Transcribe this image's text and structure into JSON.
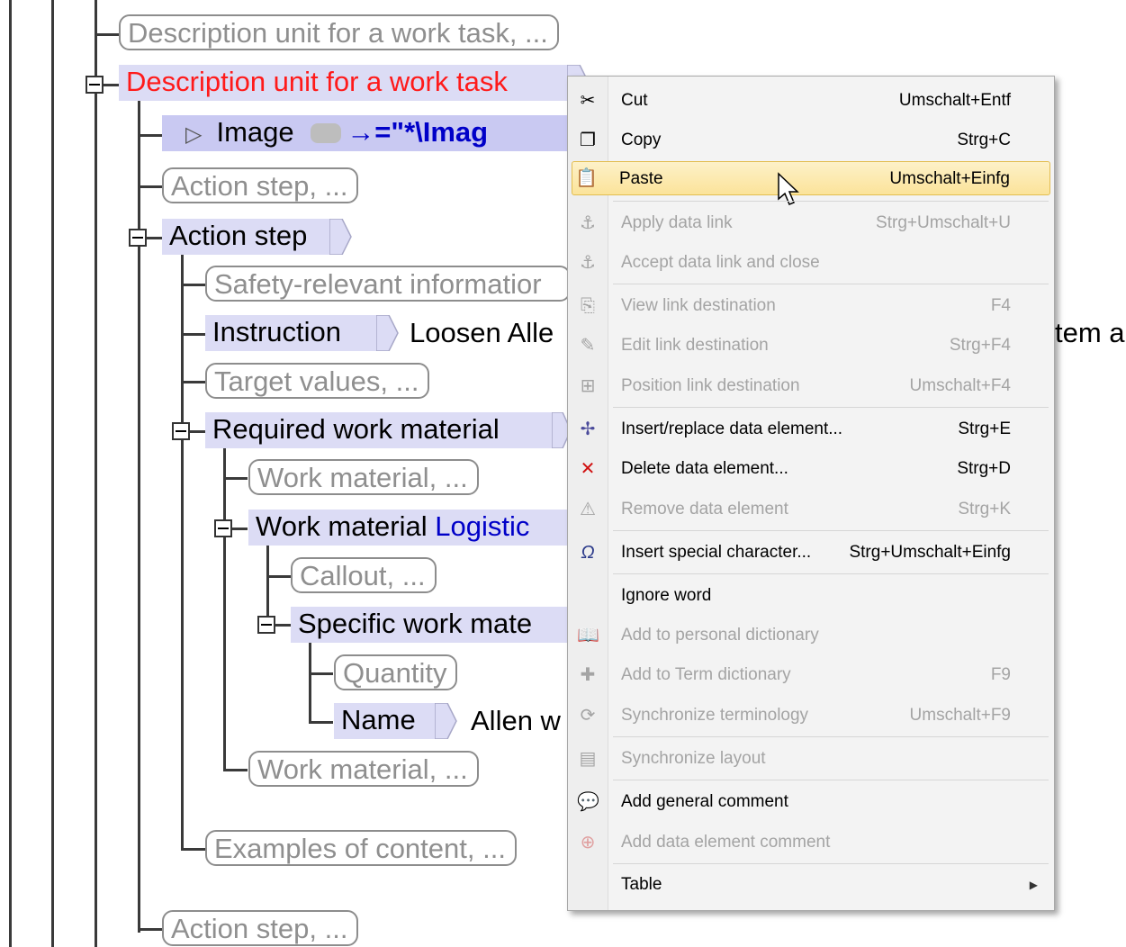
{
  "tree": {
    "row0": "Description unit for a work task, ...",
    "row1": "Description unit for a work task",
    "row2_elem": "Image",
    "row2_attr": "→=\"*\\Imag",
    "row3": "Action step, ...",
    "row4": "Action step",
    "row5": "Safety-relevant informatior",
    "row6_elem": "Instruction",
    "row6_text": "Loosen Alle",
    "row6_text_right": "tem a",
    "row7": "Target values, ...",
    "row8": "Required work material",
    "row9": "Work material, ...",
    "row10_elem": "Work material",
    "row10_link": "Logistic",
    "row11": "Callout, ...",
    "row12": "Specific work mate",
    "row13": "Quantity",
    "row14_elem": "Name",
    "row14_text": "Allen w",
    "row15": "Work material, ...",
    "row16": "Examples of content, ...",
    "row17": "Action step, ..."
  },
  "menu": {
    "items": [
      {
        "label": "Cut",
        "shortcut": "Umschalt+Entf",
        "icon": "scissors-icon",
        "enabled": true
      },
      {
        "label": "Copy",
        "shortcut": "Strg+C",
        "icon": "copy-icon",
        "enabled": true
      },
      {
        "label": "Paste",
        "shortcut": "Umschalt+Einfg",
        "icon": "paste-icon",
        "enabled": true,
        "highlighted": true
      },
      {
        "label": "Apply data link",
        "shortcut": "Strg+Umschalt+U",
        "icon": "data-link-icon",
        "enabled": false
      },
      {
        "label": "Accept data link and close",
        "shortcut": "",
        "icon": "data-link-close-icon",
        "enabled": false
      },
      {
        "label": "View link destination",
        "shortcut": "F4",
        "icon": "view-link-icon",
        "enabled": false
      },
      {
        "label": "Edit link destination",
        "shortcut": "Strg+F4",
        "icon": "edit-link-icon",
        "enabled": false
      },
      {
        "label": "Position link destination",
        "shortcut": "Umschalt+F4",
        "icon": "position-link-icon",
        "enabled": false
      },
      {
        "label": "Insert/replace data element...",
        "shortcut": "Strg+E",
        "icon": "insert-element-icon",
        "enabled": true
      },
      {
        "label": "Delete data element...",
        "shortcut": "Strg+D",
        "icon": "delete-element-icon",
        "enabled": true
      },
      {
        "label": "Remove data element",
        "shortcut": "Strg+K",
        "icon": "remove-element-icon",
        "enabled": false
      },
      {
        "label": "Insert special character...",
        "shortcut": "Strg+Umschalt+Einfg",
        "icon": "omega-icon",
        "enabled": true
      },
      {
        "label": "Ignore word",
        "shortcut": "",
        "icon": "",
        "enabled": true
      },
      {
        "label": "Add to personal dictionary",
        "shortcut": "",
        "icon": "personal-dictionary-icon",
        "enabled": false
      },
      {
        "label": "Add to Term dictionary",
        "shortcut": "F9",
        "icon": "term-dictionary-icon",
        "enabled": false
      },
      {
        "label": "Synchronize terminology",
        "shortcut": "Umschalt+F9",
        "icon": "sync-terminology-icon",
        "enabled": false
      },
      {
        "label": "Synchronize layout",
        "shortcut": "",
        "icon": "sync-layout-icon",
        "enabled": false
      },
      {
        "label": "Add general comment",
        "shortcut": "",
        "icon": "general-comment-icon",
        "enabled": true
      },
      {
        "label": "Add data element comment",
        "shortcut": "",
        "icon": "element-comment-icon",
        "enabled": false
      },
      {
        "label": "Table",
        "shortcut": "",
        "icon": "",
        "enabled": true,
        "submenu": true
      }
    ]
  }
}
